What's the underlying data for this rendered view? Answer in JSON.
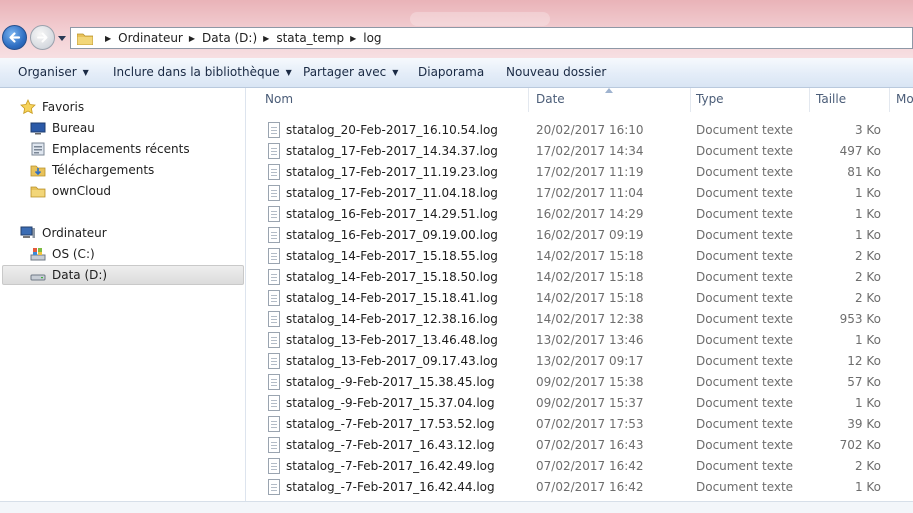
{
  "nav_buttons": {
    "back_icon": "back-arrow-icon",
    "forward_icon": "forward-arrow-icon"
  },
  "address": {
    "crumbs": [
      "Ordinateur",
      "Data (D:)",
      "stata_temp",
      "log"
    ]
  },
  "toolbar": {
    "organize": "Organiser",
    "include_library": "Inclure dans la bibliothèque",
    "share": "Partager avec",
    "slideshow": "Diaporama",
    "new_folder": "Nouveau dossier"
  },
  "sidebar": {
    "favorites_label": "Favoris",
    "favorites": [
      "Bureau",
      "Emplacements récents",
      "Téléchargements",
      "ownCloud"
    ],
    "computer_label": "Ordinateur",
    "drives": [
      "OS (C:)",
      "Data (D:)"
    ],
    "selected": "Data (D:)"
  },
  "columns": {
    "name": "Nom",
    "date": "Date",
    "type": "Type",
    "size": "Taille",
    "more": "Mo"
  },
  "files": [
    {
      "name": "statalog_20-Feb-2017_16.10.54.log",
      "date": "20/02/2017 16:10",
      "type": "Document texte",
      "size": "3 Ko"
    },
    {
      "name": "statalog_17-Feb-2017_14.34.37.log",
      "date": "17/02/2017 14:34",
      "type": "Document texte",
      "size": "497 Ko"
    },
    {
      "name": "statalog_17-Feb-2017_11.19.23.log",
      "date": "17/02/2017 11:19",
      "type": "Document texte",
      "size": "81 Ko"
    },
    {
      "name": "statalog_17-Feb-2017_11.04.18.log",
      "date": "17/02/2017 11:04",
      "type": "Document texte",
      "size": "1 Ko"
    },
    {
      "name": "statalog_16-Feb-2017_14.29.51.log",
      "date": "16/02/2017 14:29",
      "type": "Document texte",
      "size": "1 Ko"
    },
    {
      "name": "statalog_16-Feb-2017_09.19.00.log",
      "date": "16/02/2017 09:19",
      "type": "Document texte",
      "size": "1 Ko"
    },
    {
      "name": "statalog_14-Feb-2017_15.18.55.log",
      "date": "14/02/2017 15:18",
      "type": "Document texte",
      "size": "2 Ko"
    },
    {
      "name": "statalog_14-Feb-2017_15.18.50.log",
      "date": "14/02/2017 15:18",
      "type": "Document texte",
      "size": "2 Ko"
    },
    {
      "name": "statalog_14-Feb-2017_15.18.41.log",
      "date": "14/02/2017 15:18",
      "type": "Document texte",
      "size": "2 Ko"
    },
    {
      "name": "statalog_14-Feb-2017_12.38.16.log",
      "date": "14/02/2017 12:38",
      "type": "Document texte",
      "size": "953 Ko"
    },
    {
      "name": "statalog_13-Feb-2017_13.46.48.log",
      "date": "13/02/2017 13:46",
      "type": "Document texte",
      "size": "1 Ko"
    },
    {
      "name": "statalog_13-Feb-2017_09.17.43.log",
      "date": "13/02/2017 09:17",
      "type": "Document texte",
      "size": "12 Ko"
    },
    {
      "name": "statalog_-9-Feb-2017_15.38.45.log",
      "date": "09/02/2017 15:38",
      "type": "Document texte",
      "size": "57 Ko"
    },
    {
      "name": "statalog_-9-Feb-2017_15.37.04.log",
      "date": "09/02/2017 15:37",
      "type": "Document texte",
      "size": "1 Ko"
    },
    {
      "name": "statalog_-7-Feb-2017_17.53.52.log",
      "date": "07/02/2017 17:53",
      "type": "Document texte",
      "size": "39 Ko"
    },
    {
      "name": "statalog_-7-Feb-2017_16.43.12.log",
      "date": "07/02/2017 16:43",
      "type": "Document texte",
      "size": "702 Ko"
    },
    {
      "name": "statalog_-7-Feb-2017_16.42.49.log",
      "date": "07/02/2017 16:42",
      "type": "Document texte",
      "size": "2 Ko"
    },
    {
      "name": "statalog_-7-Feb-2017_16.42.44.log",
      "date": "07/02/2017 16:42",
      "type": "Document texte",
      "size": "1 Ko"
    }
  ],
  "colors": {
    "toolbar_text": "#1a2a44",
    "header_text": "#4b5d78",
    "meta_text": "#6d6d6d",
    "titlebar": "#f3cfd3"
  }
}
